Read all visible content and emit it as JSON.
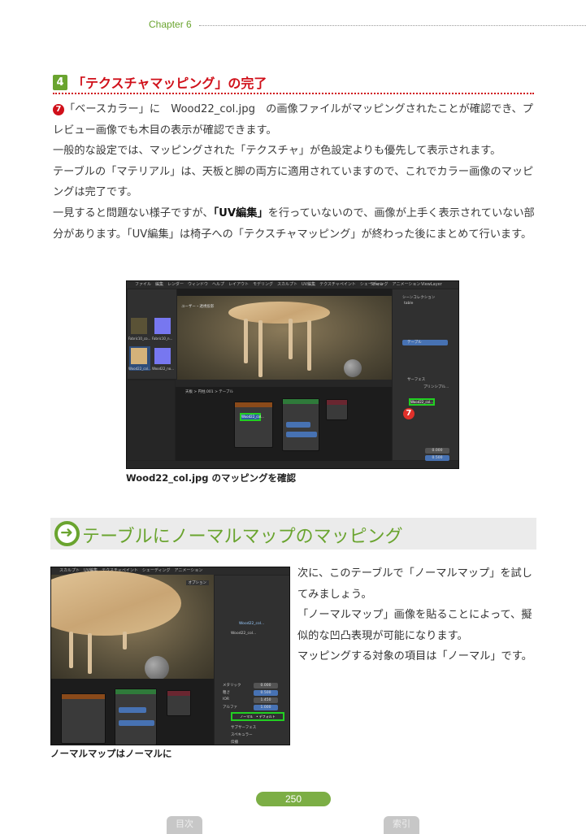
{
  "header": {
    "chapter": "Chapter 6"
  },
  "section1": {
    "number": "4",
    "title": "「テクスチャマッピング」の完了",
    "marker": "7",
    "p1_a": "「ベースカラー」に　Wood22_col.jpg　の画像ファイルがマッピングされたことが確認でき、プレビュー画像でも木目の表示が確認できます。",
    "p2": "一般的な設定では、マッピングされた「テクスチャ」が色設定よりも優先して表示されます。",
    "p3": "テーブルの「マテリアル」は、天板と脚の両方に適用されていますので、これでカラー画像のマッピングは完了です。",
    "p4_a": "一見すると問題ない様子ですが、",
    "p4_bold": "「UV編集」",
    "p4_b": "を行っていないので、画像が上手く表示されていない部分があります。「UV編集」は椅子への「テクスチャマッピング」が終わった後にまとめて行います。",
    "figure": {
      "menu": "ファイル　編集　レンダー　ウィンドウ　ヘルプ　レイアウト　モデリング　スカルプト　UV編集　テクスチャペイント　シェーディング　アニメーション",
      "scene": "Scene",
      "viewlayer": "ViewLayer",
      "thumbs": [
        "Fabric10_co...",
        "Fabric10_n...",
        "Wood22_col...",
        "Wood22_no..."
      ],
      "viewport_label": "ユーザー・透視投影",
      "collection": "シーンコレクション",
      "table": "table",
      "material": "テーブル",
      "surface": "サーフェス",
      "bsdf": "プリンシプル...",
      "image_node": "Wood22_col...",
      "marker": "7",
      "node_breadcrumb": "天板 > 円柱.001 > テーブル",
      "values": [
        "0.000",
        "0.500"
      ]
    },
    "caption": "Wood22_col.jpg のマッピングを確認"
  },
  "section2": {
    "title": "テーブルにノーマルマップのマッピング",
    "paragraph": "次に、このテーブルで「ノーマルマップ」を試してみましょう。\n「ノーマルマップ」画像を貼ることによって、擬似的な凹凸表現が可能になります。\nマッピングする対象の項目は「ノーマル」です。",
    "figure": {
      "menu": "スカルプト　UV編集　テクスチャペイント　シェーディング　アニメーション",
      "options": "オプション",
      "image": "Wood22_col...",
      "props": [
        {
          "label": "メタリック",
          "value": "0.000"
        },
        {
          "label": "粗さ",
          "value": "0.500"
        },
        {
          "label": "IOR",
          "value": "1.450"
        },
        {
          "label": "アルファ",
          "value": "1.000"
        }
      ],
      "normal": "ノーマル　• デフォルト",
      "sub": [
        "サブサーフェス",
        "スペキュラー",
        "伝播"
      ]
    },
    "caption": "ノーマルマップはノーマルに"
  },
  "footer": {
    "page": "250",
    "toc": "目次",
    "index": "索引"
  }
}
